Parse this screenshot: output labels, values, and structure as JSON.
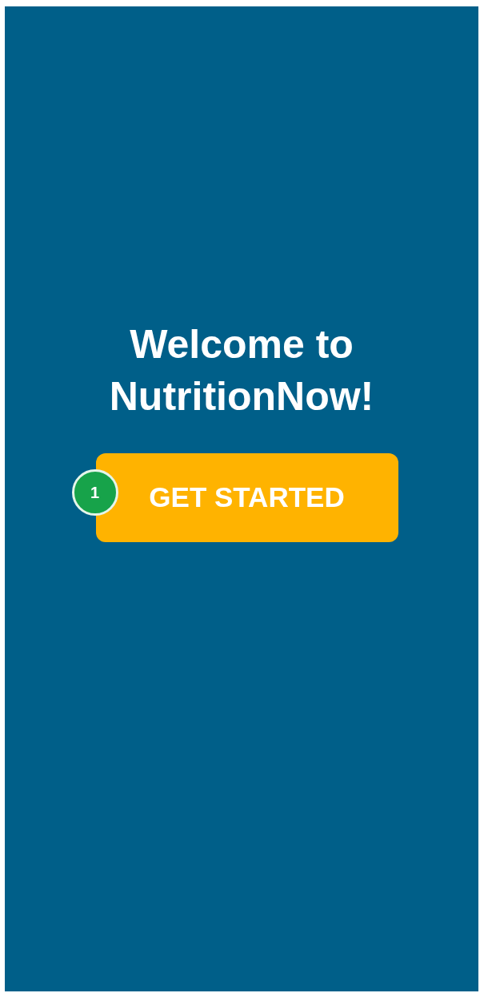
{
  "title": "Welcome to NutritionNow!",
  "button": {
    "label": "GET STARTED",
    "badge": "1"
  }
}
